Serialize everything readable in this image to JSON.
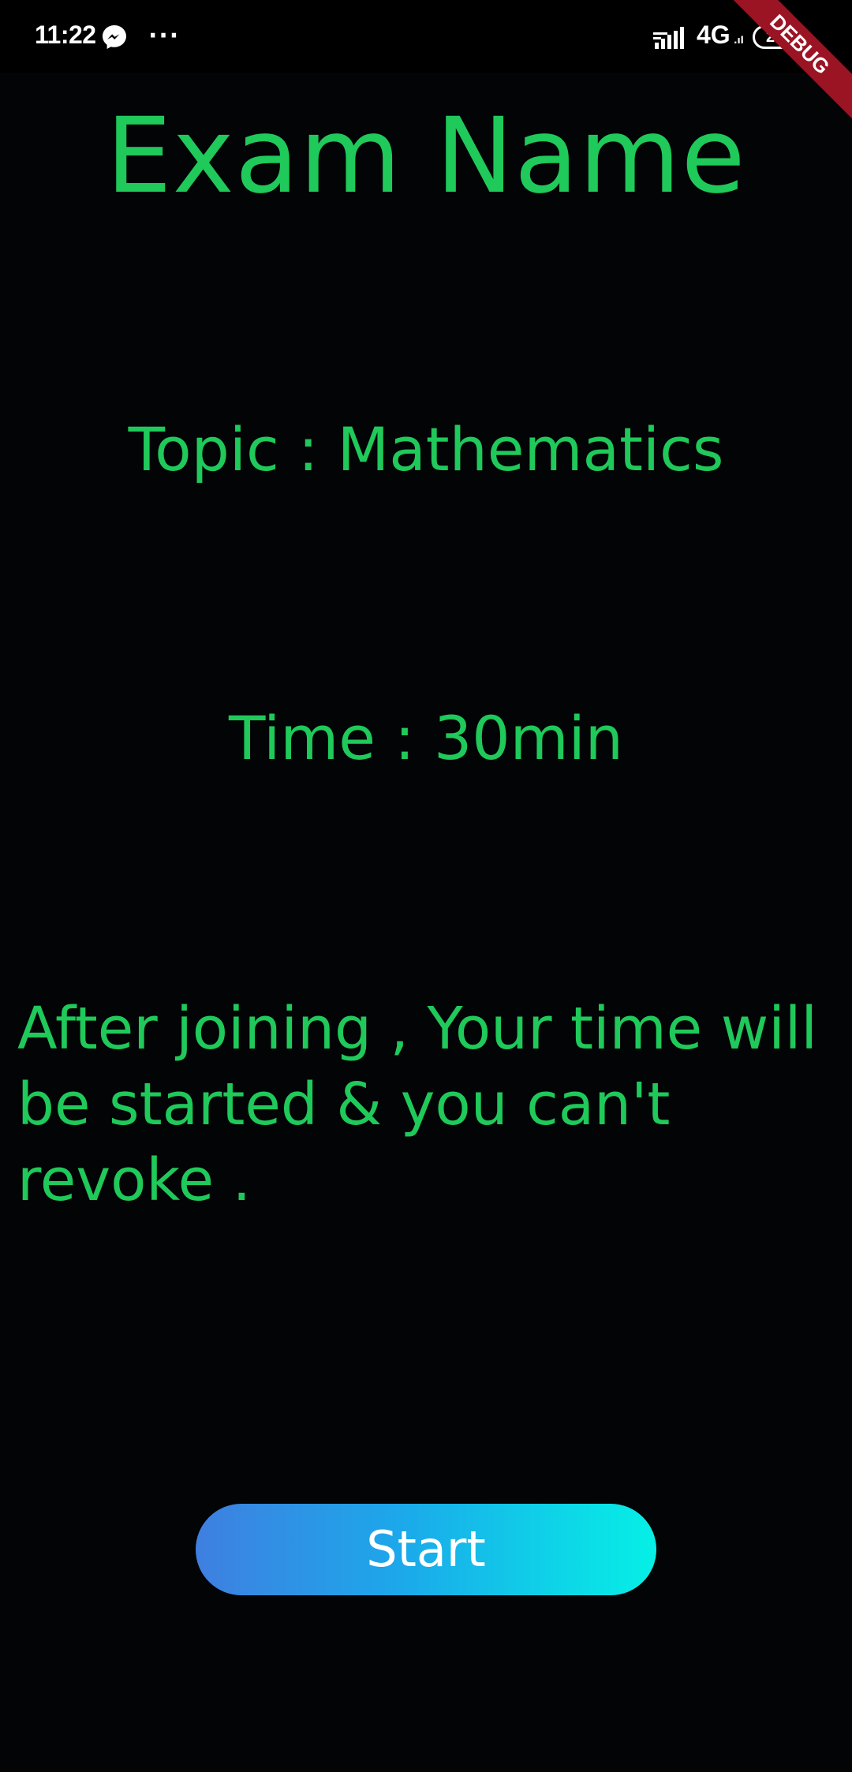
{
  "status_bar": {
    "time": "11:22",
    "more_indicator": "···",
    "network": "4G",
    "network_sub": ".ıl",
    "battery_level": "26"
  },
  "debug_banner": {
    "label": "DEBUG"
  },
  "exam": {
    "title": "Exam Name",
    "topic": "Topic : Mathematics",
    "time": "Time : 30min",
    "notice": "After joining , Your time will be started & you can't revoke ."
  },
  "actions": {
    "start_label": "Start"
  },
  "colors": {
    "background": "#030406",
    "text_accent": "#1fc95a",
    "button_gradient_start": "#3f7fe0",
    "button_gradient_end": "#05f0e6",
    "debug_ribbon": "#9b1424"
  },
  "icons": {
    "messenger": "messenger-icon",
    "signal": "signal-icon",
    "battery": "battery-icon"
  }
}
